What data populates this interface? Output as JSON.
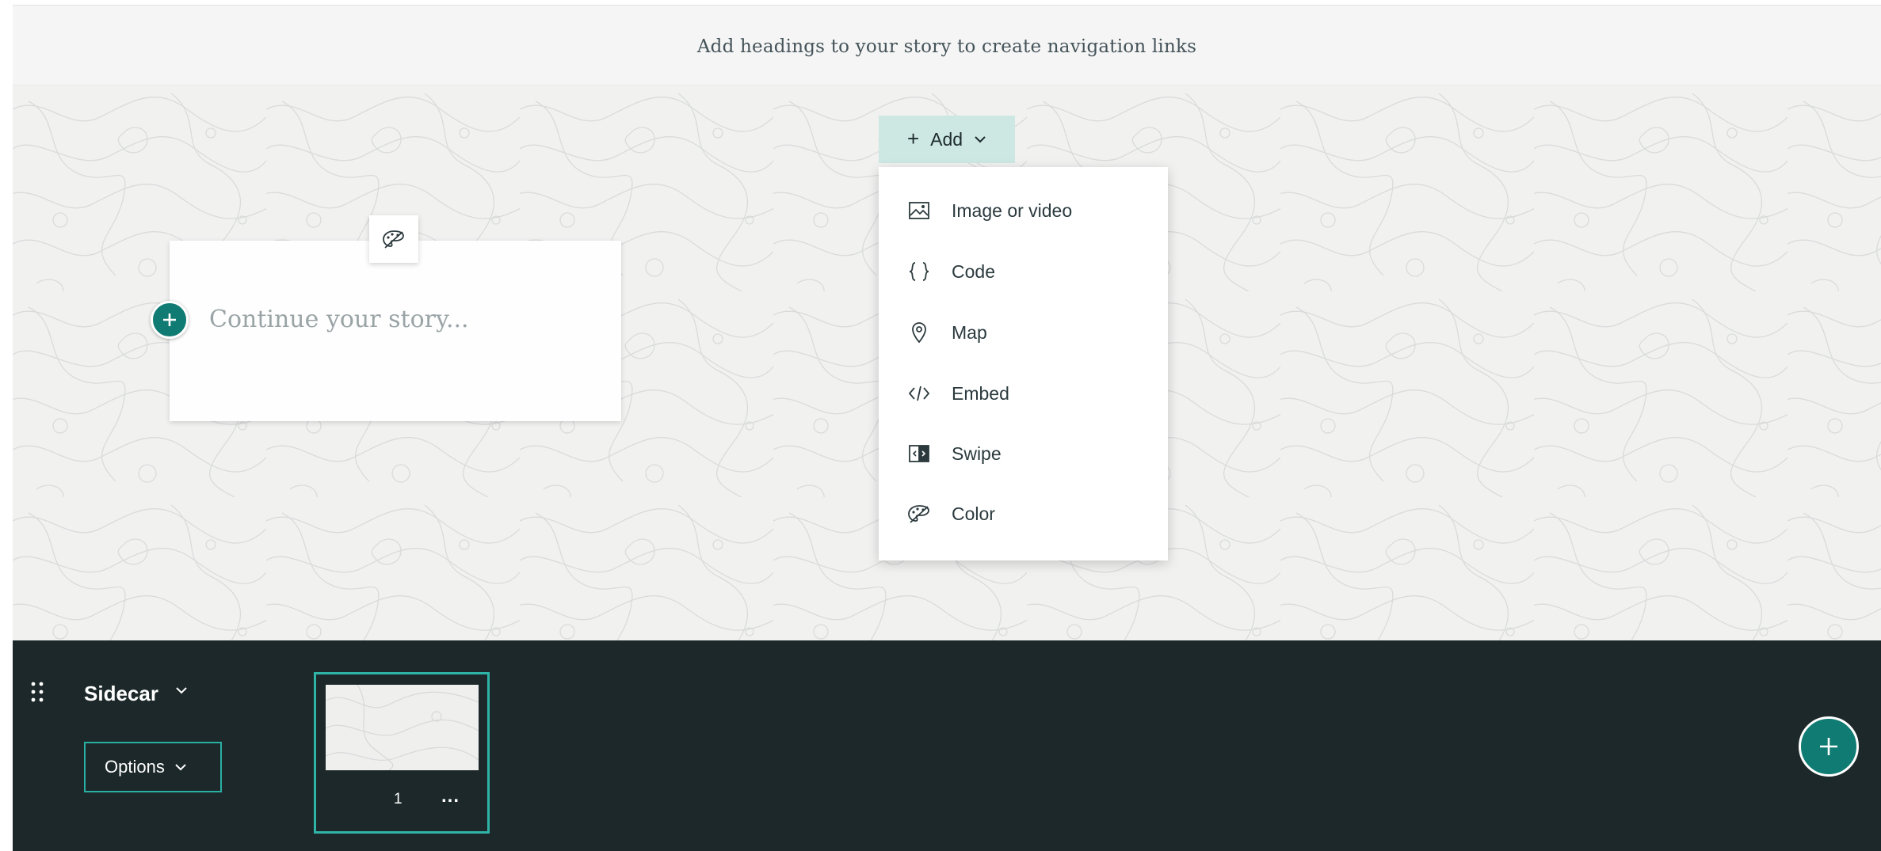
{
  "navigation": {
    "hint_text": "Add headings to your story to create navigation links"
  },
  "story_card": {
    "placeholder": "Continue your story..."
  },
  "add_menu": {
    "button_label": "Add",
    "items": [
      {
        "label": "Image or video",
        "icon": "image-icon"
      },
      {
        "label": "Code",
        "icon": "code-braces-icon"
      },
      {
        "label": "Map",
        "icon": "map-pin-icon"
      },
      {
        "label": "Embed",
        "icon": "embed-icon"
      },
      {
        "label": "Swipe",
        "icon": "swipe-icon"
      },
      {
        "label": "Color",
        "icon": "palette-icon"
      }
    ]
  },
  "sidecar": {
    "title": "Sidecar",
    "options_label": "Options",
    "slides": [
      {
        "number": "1",
        "more_label": "..."
      }
    ]
  },
  "colors": {
    "accent": "#0f7b73",
    "accent_light": "#cde7e3",
    "panel_bg": "#1c2829",
    "selection_border": "#2fb4a8"
  }
}
